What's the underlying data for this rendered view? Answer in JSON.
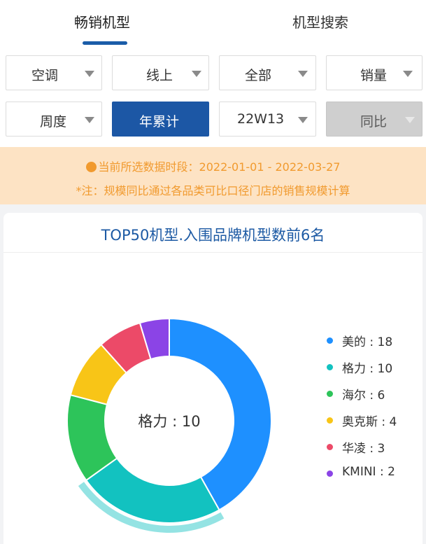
{
  "tabs": [
    {
      "label": "畅销机型",
      "active": true
    },
    {
      "label": "机型搜索",
      "active": false
    }
  ],
  "filters": {
    "row1": [
      "空调",
      "线上",
      "全部",
      "销量"
    ],
    "row2": [
      {
        "label": "周度",
        "state": "normal"
      },
      {
        "label": "年累计",
        "state": "active"
      },
      {
        "label": "22W13",
        "state": "normal"
      },
      {
        "label": "同比",
        "state": "disabled"
      }
    ]
  },
  "notice": {
    "line1": "当前所选数据时段：2022-01-01 - 2022-03-27",
    "line2": "*注：规模同比通过各品类可比口径门店的销售规模计算"
  },
  "chart_data": {
    "type": "pie",
    "title": "TOP50机型.入围品牌机型数前6名",
    "center_label": "格力 : 10",
    "highlighted": "格力",
    "slices": [
      {
        "name": "美的",
        "value": 18,
        "color": "#1e90ff"
      },
      {
        "name": "格力",
        "value": 10,
        "color": "#12c2c0"
      },
      {
        "name": "海尔",
        "value": 6,
        "color": "#2dc45a"
      },
      {
        "name": "奥克斯",
        "value": 4,
        "color": "#f8c517"
      },
      {
        "name": "华凌",
        "value": 3,
        "color": "#ec4a68"
      },
      {
        "name": "KMINI",
        "value": 2,
        "color": "#8b44e6"
      }
    ],
    "legend_labels": [
      "美的 : 18",
      "格力 : 10",
      "海尔 : 6",
      "奥克斯 : 4",
      "华凌 : 3",
      "KMINI : 2"
    ],
    "legend_position": "right"
  }
}
